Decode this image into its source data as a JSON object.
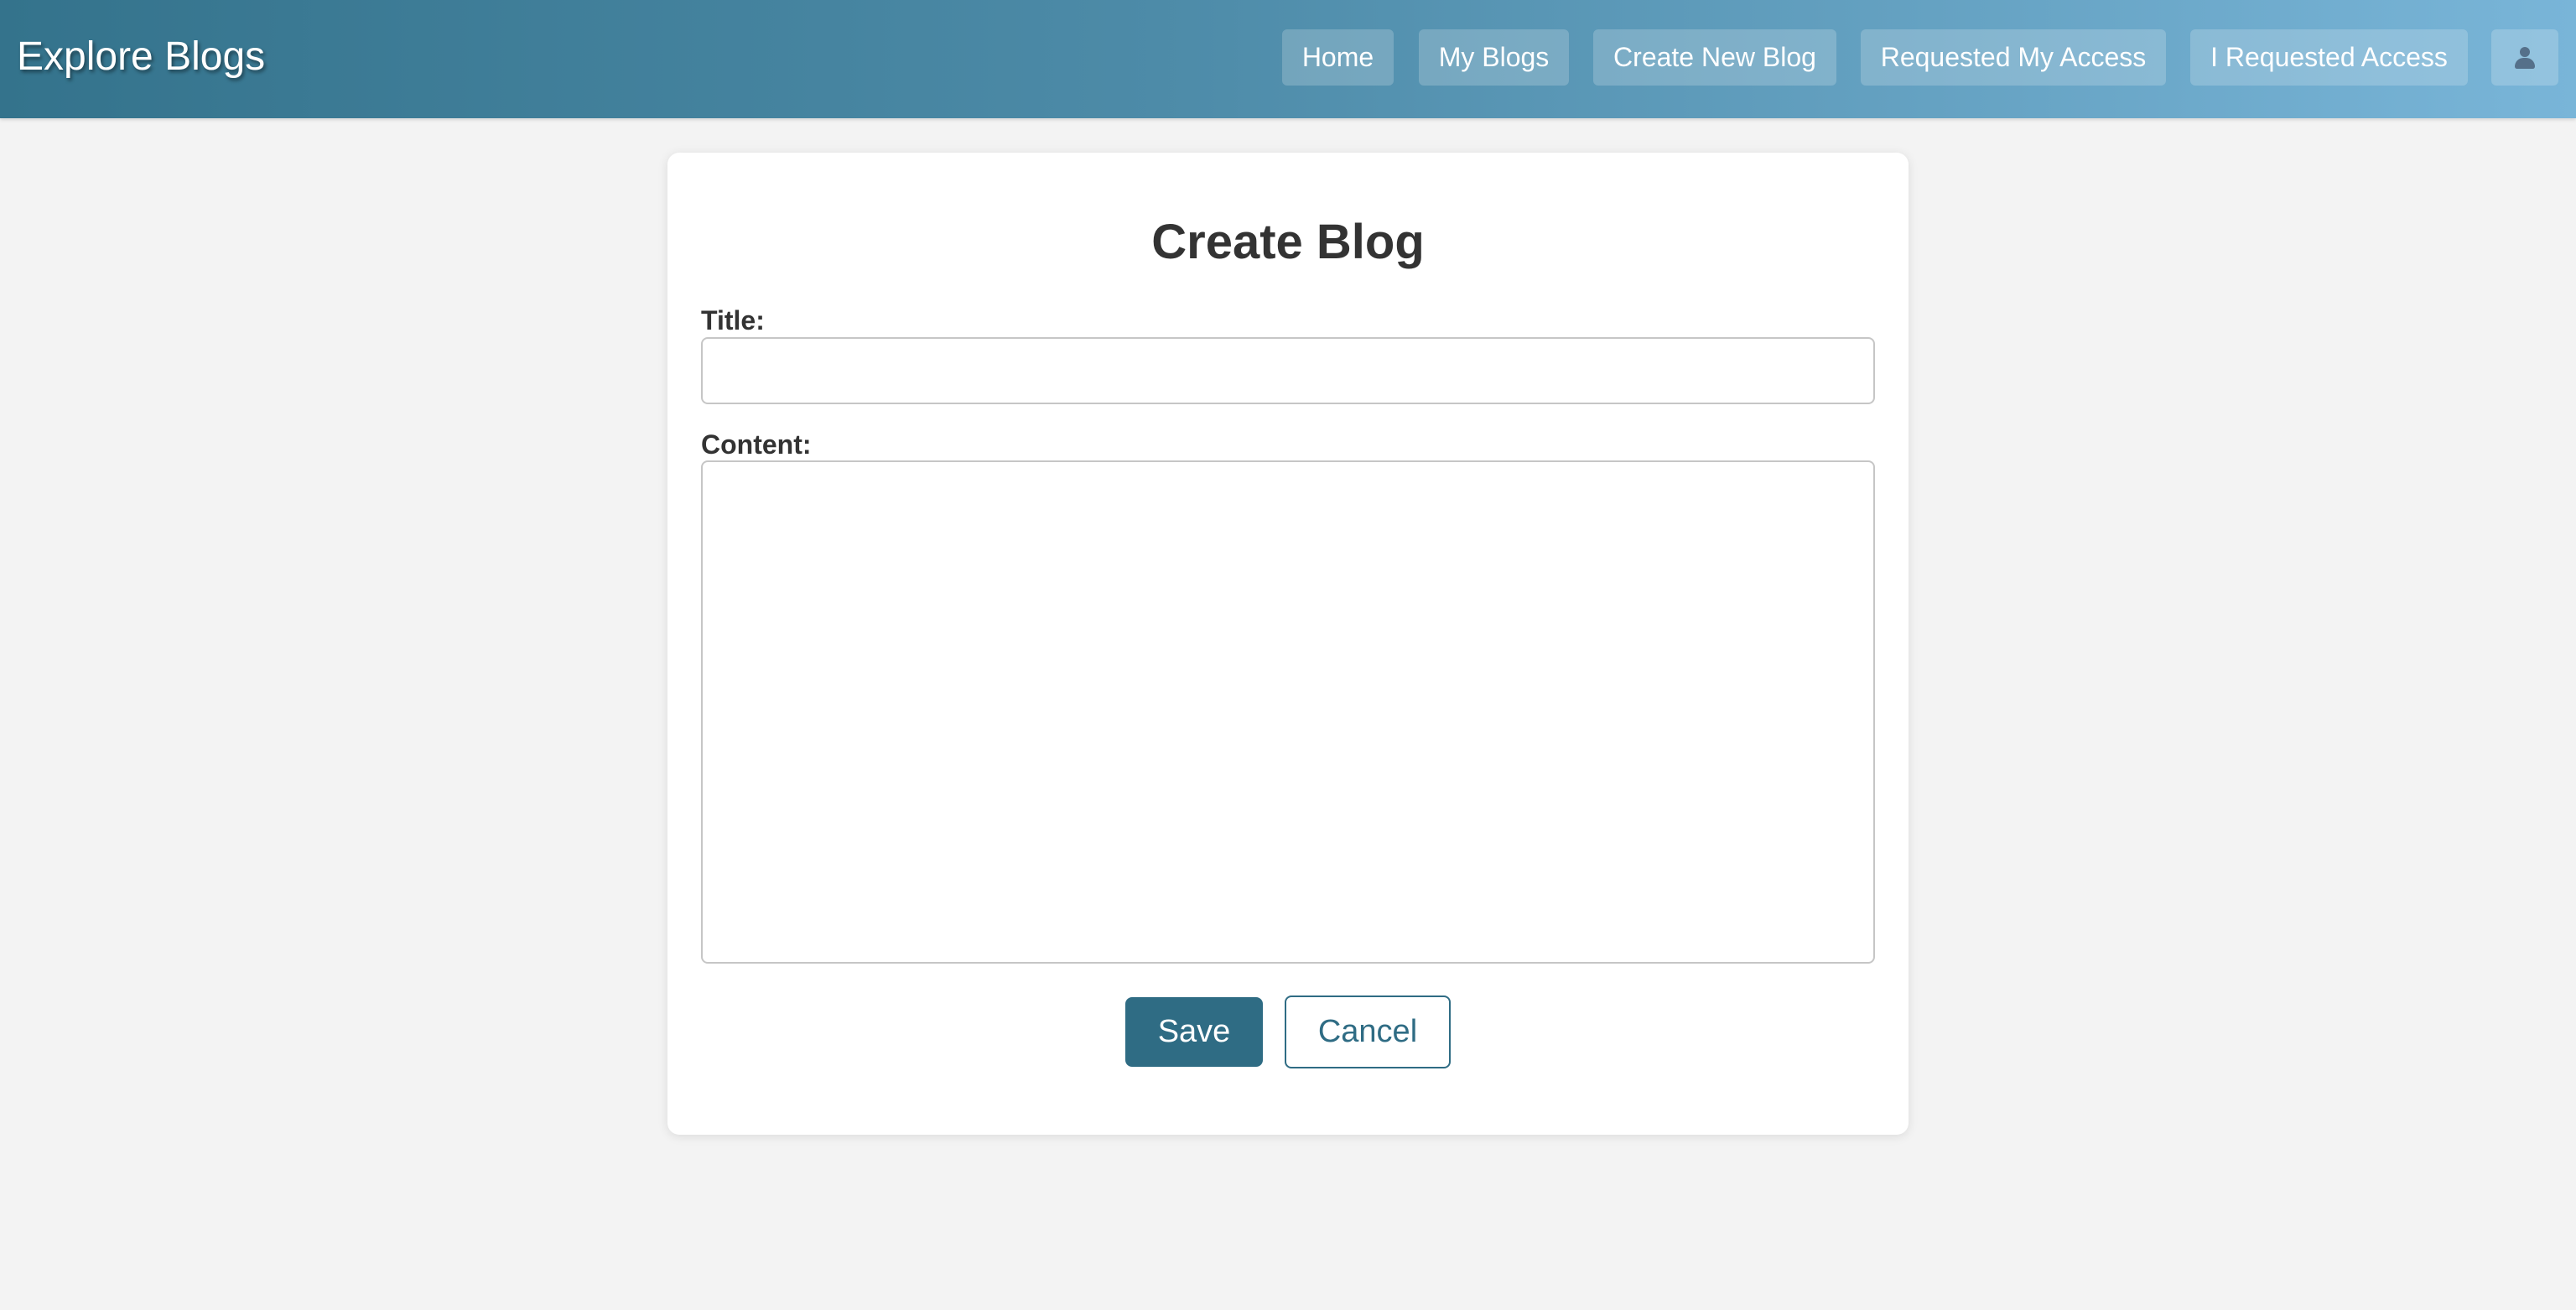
{
  "navbar": {
    "brand": "Explore Blogs",
    "items": [
      {
        "label": "Home"
      },
      {
        "label": "My Blogs"
      },
      {
        "label": "Create New Blog"
      },
      {
        "label": "Requested My Access"
      },
      {
        "label": "I Requested Access"
      }
    ],
    "user_icon": "user-icon",
    "gradient_start": "#34738c",
    "gradient_end": "#79b5d8"
  },
  "form": {
    "heading": "Create Blog",
    "title_label": "Title:",
    "title_value": "",
    "content_label": "Content:",
    "content_value": "",
    "save_label": "Save",
    "cancel_label": "Cancel",
    "accent_color": "#2f6c84"
  }
}
